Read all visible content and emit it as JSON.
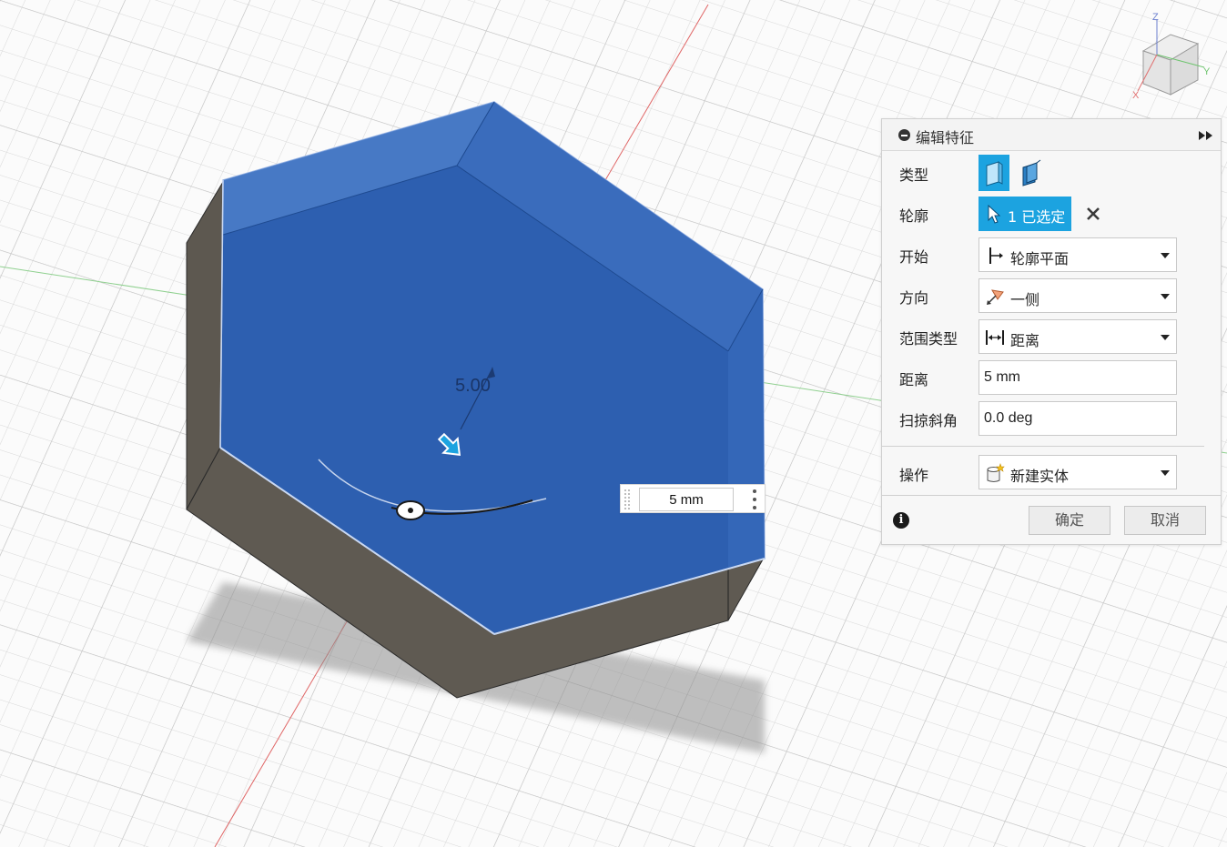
{
  "viewport": {
    "dimension_label": "5.00",
    "inline_distance_value": "5 mm"
  },
  "viewcube": {
    "axis_x": "X",
    "axis_y": "Y",
    "axis_z": "Z"
  },
  "panel": {
    "title": "编辑特征",
    "rows": {
      "type": {
        "label": "类型"
      },
      "profile": {
        "label": "轮廓",
        "selection": "1 已选定"
      },
      "start": {
        "label": "开始",
        "value": "轮廓平面"
      },
      "direction": {
        "label": "方向",
        "value": "一侧"
      },
      "extent_type": {
        "label": "范围类型",
        "value": "距离"
      },
      "distance": {
        "label": "距离",
        "value": "5 mm"
      },
      "taper_angle": {
        "label": "扫掠斜角",
        "value": "0.0 deg"
      },
      "operation": {
        "label": "操作",
        "value": "新建实体"
      }
    },
    "ok_label": "确定",
    "cancel_label": "取消",
    "info_icon_glyph": "i"
  },
  "colors": {
    "selection_blue": "#2d5fb0",
    "accent_blue": "#1ca3e0",
    "solid_gray": "#5f5a52"
  }
}
